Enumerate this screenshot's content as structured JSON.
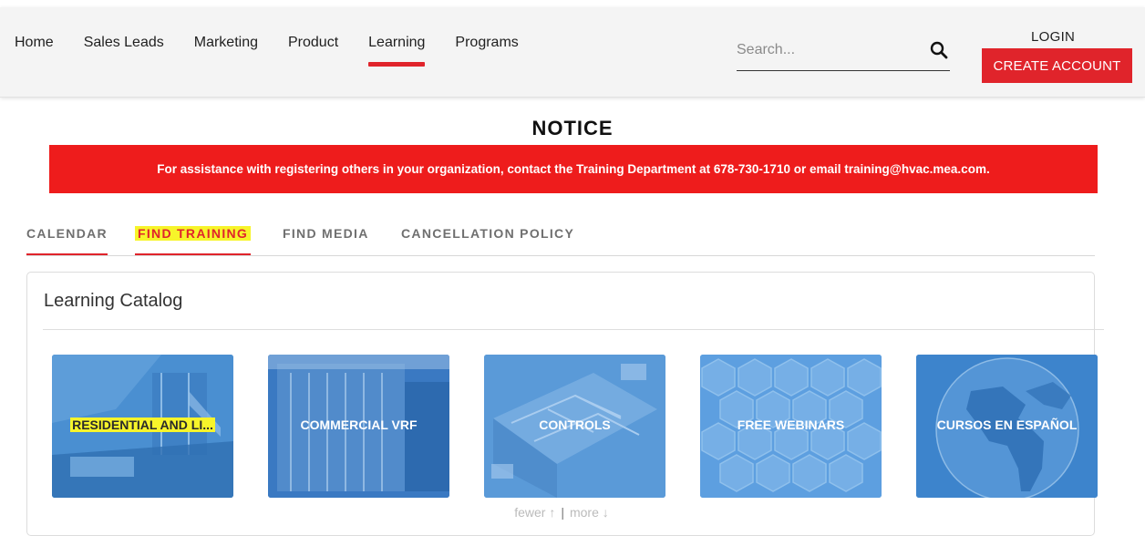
{
  "nav": {
    "items": [
      {
        "label": "Home"
      },
      {
        "label": "Sales Leads"
      },
      {
        "label": "Marketing"
      },
      {
        "label": "Product"
      },
      {
        "label": "Learning"
      },
      {
        "label": "Programs"
      }
    ],
    "active": "Learning"
  },
  "search": {
    "placeholder": "Search...",
    "icon": "magnifier"
  },
  "account": {
    "login_label": "LOGIN",
    "create_label": "CREATE ACCOUNT"
  },
  "notice": {
    "title": "NOTICE",
    "message": "For assistance with registering others in your organization, contact the Training Department at 678-730-1710 or email training@hvac.mea.com."
  },
  "tabs": [
    {
      "label": "CALENDAR"
    },
    {
      "label": "FIND TRAINING"
    },
    {
      "label": "FIND MEDIA"
    },
    {
      "label": "CANCELLATION POLICY"
    }
  ],
  "catalog": {
    "title": "Learning Catalog",
    "cards": [
      {
        "label": "RESIDENTIAL AND LI..."
      },
      {
        "label": "COMMERCIAL VRF"
      },
      {
        "label": "CONTROLS"
      },
      {
        "label": "FREE WEBINARS"
      },
      {
        "label": "CURSOS EN ESPAÑOL"
      }
    ],
    "pager": {
      "fewer": "fewer ↑",
      "more": "more ↓"
    }
  },
  "colors": {
    "brand_red": "#e0242b",
    "highlight_yellow": "#f7f42a",
    "card_blue": "#3d84cc"
  }
}
